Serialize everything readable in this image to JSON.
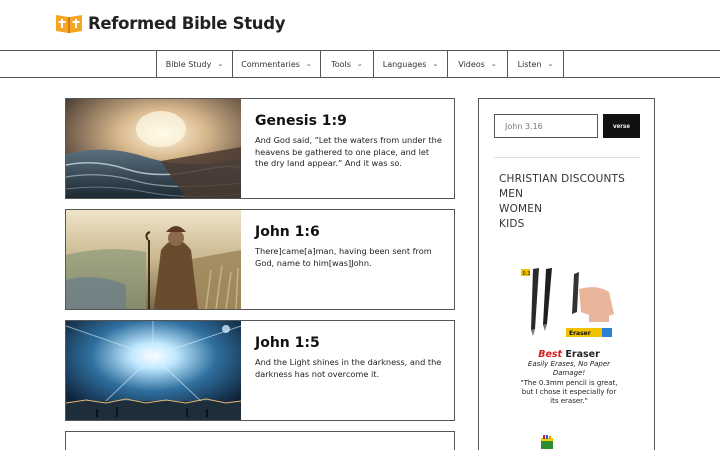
{
  "header": {
    "site_title": "Reformed Bible Study",
    "logo_icon": "open-bible-cross-icon",
    "brand_color": "#f5a623"
  },
  "nav": {
    "items": [
      {
        "label": "Bible Study"
      },
      {
        "label": "Commentaries"
      },
      {
        "label": "Tools"
      },
      {
        "label": "Languages"
      },
      {
        "label": "Videos"
      },
      {
        "label": "Listen"
      }
    ]
  },
  "posts": [
    {
      "title": "Genesis 1:9",
      "excerpt": "And God said, “Let the waters from under the heavens be gathered to one place, and let the dry land appear.” And it was so."
    },
    {
      "title": "John 1:6",
      "excerpt": "There]came[a]man, having been sent from God, name to him[was]John."
    },
    {
      "title": "John 1:5",
      "excerpt": "And the Light shines in the darkness, and the darkness has not overcome it."
    }
  ],
  "sidebar": {
    "search_placeholder": "John 3.16",
    "search_button": "verse",
    "links": [
      "CHRISTIAN DISCOUNTS",
      "MEN",
      "WOMEN",
      "KIDS"
    ],
    "ad": {
      "badge_label": "0.3",
      "product_label": "Eraser",
      "title_best": "Best",
      "title_rest": " Eraser",
      "subtitle": "Easily Erases, No Paper Damage!",
      "quote": "\"The 0.3mm pencil is great, but I chose it especially for its eraser.\""
    }
  }
}
